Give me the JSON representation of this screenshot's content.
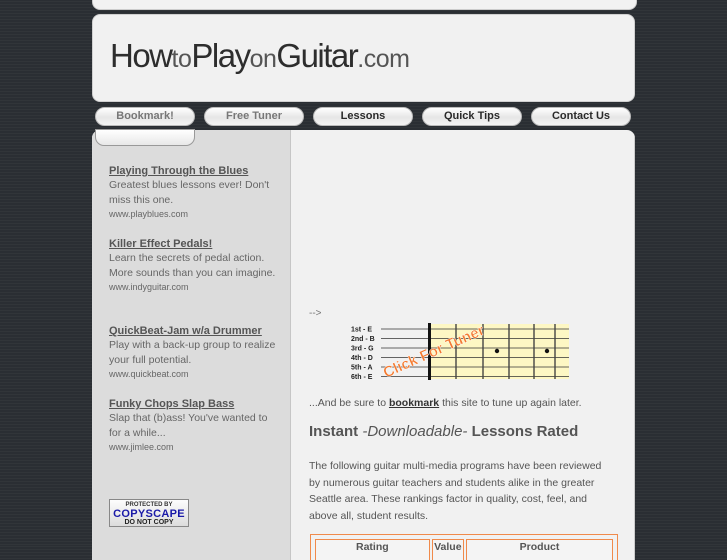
{
  "header": {
    "logo": {
      "part1": "How",
      "part2": "to",
      "part3": "Play",
      "part4": "on",
      "part5": "Guitar",
      "part6": ".com"
    }
  },
  "nav": {
    "items": [
      {
        "label": "Bookmark!"
      },
      {
        "label": "Free Tuner"
      },
      {
        "label": "Lessons"
      },
      {
        "label": "Quick Tips"
      },
      {
        "label": "Contact Us"
      }
    ]
  },
  "sidebar": {
    "ads": [
      {
        "title": "Playing Through the Blues",
        "text": "Greatest blues lessons ever! Don't miss this one.",
        "url": "www.playblues.com"
      },
      {
        "title": "Killer Effect Pedals!",
        "text": "Learn the secrets of pedal action. More sounds than you can imagine.",
        "url": "www.indyguitar.com"
      },
      {
        "title": "QuickBeat-Jam w/a Drummer",
        "text": "Play with a back-up group to realize your full potential.",
        "url": "www.quickbeat.com"
      },
      {
        "title": "Funky Chops Slap Bass",
        "text": "Slap that (b)ass! You've wanted to for a while...",
        "url": "www.jimlee.com"
      }
    ],
    "copyscape": {
      "line1": "PROTECTED BY",
      "line2": "COPYSCAPE",
      "line3": "DO NOT COPY"
    }
  },
  "main": {
    "arrow_text": "-->",
    "tuner": {
      "strings": [
        "1st - E",
        "2nd - B",
        "3rd - G",
        "4th - D",
        "5th - A",
        "6th - E"
      ],
      "overlay": "Click For Tuner"
    },
    "bookmark_line": {
      "before": "...And be sure to ",
      "link": "bookmark",
      "after": " this site to tune up again later."
    },
    "heading": {
      "before": "Instant ",
      "emph": "-Downloadable-",
      "after": " Lessons Rated"
    },
    "intro": "The following guitar multi-media programs have been reviewed by numerous guitar teachers and students alike in the greater Seattle area. These rankings factor in quality, cost, feel, and above all, student results.",
    "table": {
      "headers": [
        "Rating",
        "Value",
        "Product"
      ]
    }
  },
  "colors": {
    "accent_orange": "#f08a4b",
    "copyscape_blue": "#1a1aa8"
  }
}
